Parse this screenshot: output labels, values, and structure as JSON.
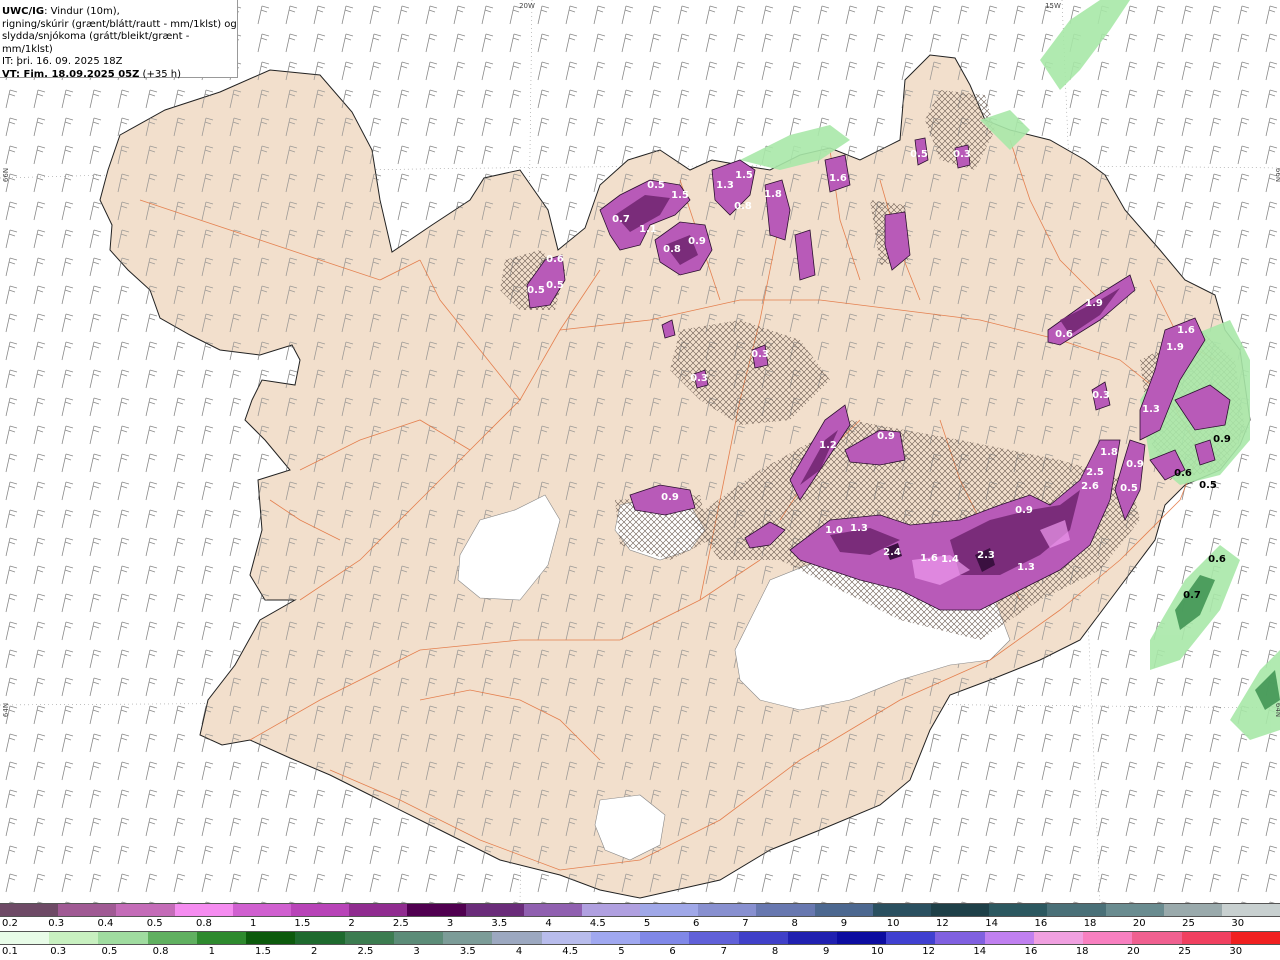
{
  "product": {
    "title": "UWC/IG",
    "description_1": ": Vindur (10m),",
    "description_2": "rigning/skúrir (grænt/blátt/rautt - mm/1klst) og",
    "description_3": "slydda/snjókoma (grátt/bleikt/grænt - mm/1klst)",
    "init_time": "IT: þri. 16. 09. 2025 18Z",
    "valid_label": "VT: Fim. 18.09.2025 05Z",
    "lead_time": " (+35 h)"
  },
  "grid_labels": [
    {
      "text": "20W",
      "kind": "lon"
    },
    {
      "text": "15W",
      "kind": "lon"
    },
    {
      "text": "66N",
      "kind": "lat-left"
    },
    {
      "text": "66N",
      "kind": "lat-right"
    },
    {
      "text": "64N",
      "kind": "lat-left"
    },
    {
      "text": "64N",
      "kind": "lat-right"
    }
  ],
  "precip_labels": [
    {
      "text": "0.5"
    },
    {
      "text": "1.5"
    },
    {
      "text": "0.7"
    },
    {
      "text": "1.1"
    },
    {
      "text": "0.8"
    },
    {
      "text": "1.3"
    },
    {
      "text": "1.5"
    },
    {
      "text": "0.8"
    },
    {
      "text": "1.8"
    },
    {
      "text": "1.6"
    },
    {
      "text": "0.5"
    },
    {
      "text": "0.9"
    },
    {
      "text": "0.5"
    },
    {
      "text": "0.6"
    },
    {
      "text": "0.5"
    },
    {
      "text": "0.3"
    },
    {
      "text": "1.9"
    },
    {
      "text": "0.6"
    },
    {
      "text": "1.6"
    },
    {
      "text": "1.9"
    },
    {
      "text": "1.3"
    },
    {
      "text": "0.3"
    },
    {
      "text": "1.2"
    },
    {
      "text": "0.9"
    },
    {
      "text": "0.9"
    },
    {
      "text": "1.0"
    },
    {
      "text": "1.3"
    },
    {
      "text": "2.4"
    },
    {
      "text": "1.6"
    },
    {
      "text": "1.4"
    },
    {
      "text": "2.3"
    },
    {
      "text": "1.3"
    },
    {
      "text": "0.9"
    },
    {
      "text": "2.6"
    },
    {
      "text": "2.5"
    },
    {
      "text": "1.8"
    },
    {
      "text": "0.5"
    },
    {
      "text": "0.9"
    },
    {
      "text": "0.6"
    },
    {
      "text": "0.9"
    },
    {
      "text": "0.5"
    },
    {
      "text": "0.6"
    },
    {
      "text": "0.7"
    },
    {
      "text": "0.3"
    },
    {
      "text": "0.3"
    }
  ],
  "legend_snow": {
    "colors": [
      "#6e4a66",
      "#a05a94",
      "#c46cb8",
      "#f58cf0",
      "#d060d0",
      "#b844b8",
      "#902c90",
      "#500050",
      "#6a2c7a",
      "#9060b0",
      "#b0a0e0",
      "#a0a8e8",
      "#8890d0",
      "#6878b0",
      "#4c6890",
      "#2a5060",
      "#1e4048",
      "#2c5860",
      "#4a7078",
      "#6a8c90",
      "#9aaaac",
      "#c8d0d0"
    ],
    "labels": [
      "0.2",
      "0.3",
      "0.4",
      "0.5",
      "0.8",
      "1",
      "1.5",
      "2",
      "2.5",
      "3",
      "3.5",
      "4",
      "4.5",
      "5",
      "6",
      "7",
      "8",
      "9",
      "10",
      "12",
      "14",
      "16",
      "18",
      "20",
      "25",
      "30"
    ]
  },
  "legend_rain": {
    "colors": [
      "#e8fce8",
      "#c8f0c0",
      "#a0dca0",
      "#60b060",
      "#2e8a2e",
      "#0c5a0c",
      "#1e6a2e",
      "#3c7c50",
      "#5c8c78",
      "#7c9c98",
      "#9ca8c0",
      "#b8bcec",
      "#a0a8f0",
      "#8088e8",
      "#6060d8",
      "#4040c8",
      "#2020b0",
      "#0c0ca0",
      "#4040d0",
      "#8060e0",
      "#c080f0",
      "#f0a0e0",
      "#f880c0",
      "#f06090",
      "#f04060",
      "#f02020"
    ],
    "labels": [
      "0.1",
      "0.3",
      "0.5",
      "0.8",
      "1",
      "1.5",
      "2",
      "2.5",
      "3",
      "3.5",
      "4",
      "4.5",
      "5",
      "6",
      "7",
      "8",
      "9",
      "10",
      "12",
      "14",
      "16",
      "18",
      "20",
      "25",
      "30"
    ]
  }
}
